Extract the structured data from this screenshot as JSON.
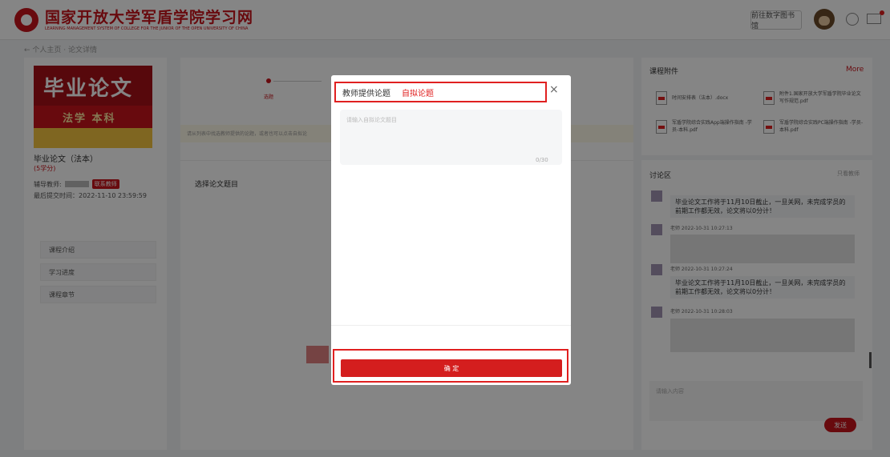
{
  "header": {
    "logo_title": "国家开放大学军盾学院学习网",
    "logo_subtitle": "LEARNING MANAGEMENT SYSTEM OF COLLEGE FOR THE JUNIOR OF THE OPEN UNIVERSITY OF CHINA",
    "library_button": "前往数字图书馆"
  },
  "breadcrumb": "← 个人主页 · 论文详情",
  "course": {
    "cover_title": "毕业论文",
    "cover_subtitle": "法学 本科",
    "name": "毕业论文（法本）",
    "credit": "(5学分)",
    "tutor_label": "辅导教师:",
    "contact_button": "联系教师",
    "last_submit": "最后提交时间：2022-11-10 23:59:59"
  },
  "menu": [
    {
      "label": "课程介绍"
    },
    {
      "label": "学习进度"
    },
    {
      "label": "课程章节"
    }
  ],
  "steps": {
    "current_label": "选题"
  },
  "tip": "请从列表中找选教师提供的论题，或者也可以点击自拟论",
  "topic_card": {
    "title": "选择论文题目"
  },
  "attachments": {
    "title": "课程附件",
    "more": "More",
    "items": [
      {
        "name": "时间安排表（法本）.docx"
      },
      {
        "name": "附件1.国家开放大学军盾学院毕业论文写作规范.pdf"
      },
      {
        "name": "军盾学院综合实践App端操作指南 -学员-本科.pdf"
      },
      {
        "name": "军盾学院综合实践PC端操作指南 -学员-本科.pdf"
      }
    ]
  },
  "discussion": {
    "title": "讨论区",
    "filter": "只看教师",
    "messages": [
      {
        "text": "毕业论文工作将于11月10日截止，一旦关网，未完成学员的前期工作都无效，论文将以0分计！"
      },
      {
        "meta": "老师  2022-10-31 10:27:13"
      },
      {
        "meta": "老师  2022-10-31 10:27:24",
        "text": "毕业论文工作将于11月10日截止，一旦关网，未完成学员的前期工作都无效，论文将以0分计！"
      },
      {
        "meta": "老师  2022-10-31 10:28:03"
      }
    ],
    "input_placeholder": "请输入内容",
    "send_button": "发送"
  },
  "modal": {
    "tab_teacher": "教师提供论题",
    "tab_custom": "自拟论题",
    "close": "×",
    "placeholder": "请输入自拟论文题目",
    "counter": "0/30",
    "confirm": "确 定"
  }
}
